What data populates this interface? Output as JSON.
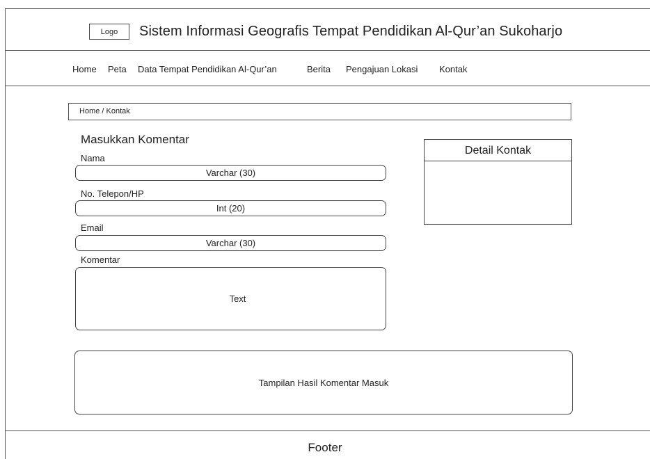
{
  "header": {
    "logo_text": "Logo",
    "title": "Sistem Informasi Geografis Tempat Pendidikan Al-Qur’an Sukoharjo"
  },
  "nav": {
    "items": [
      "Home",
      "Peta",
      "Data Tempat Pendidikan Al-Qur’an",
      "Berita",
      "Pengajuan Lokasi",
      "Kontak"
    ]
  },
  "breadcrumb": "Home / Kontak",
  "form": {
    "title": "Masukkan Komentar",
    "fields": [
      {
        "label": "Nama",
        "value": "Varchar (30)"
      },
      {
        "label": "No. Telepon/HP",
        "value": "Int (20)"
      },
      {
        "label": "Email",
        "value": "Varchar (30)"
      },
      {
        "label": "Komentar",
        "value": "Text"
      }
    ]
  },
  "detail": {
    "title": "Detail Kontak"
  },
  "results": {
    "text": "Tampilan Hasil Komentar Masuk"
  },
  "footer": {
    "text": "Footer"
  }
}
